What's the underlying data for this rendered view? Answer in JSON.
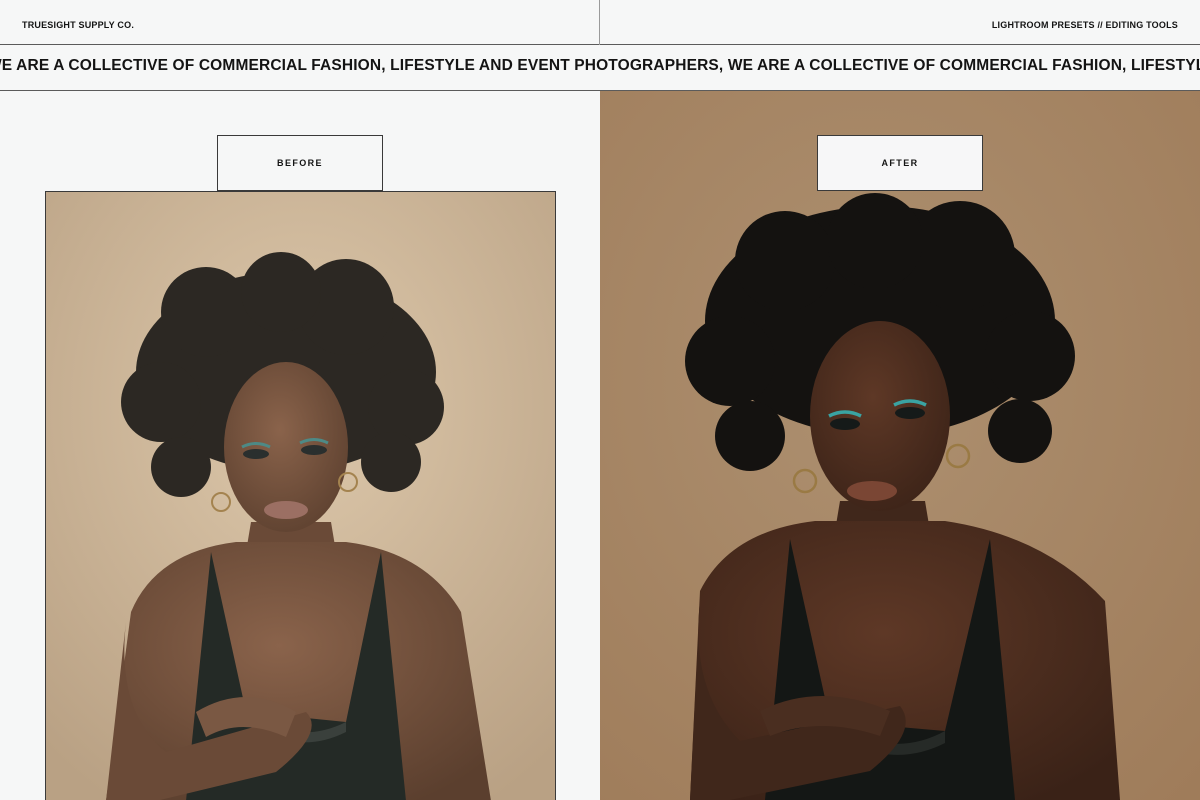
{
  "header": {
    "brand": "TRUESIGHT SUPPLY CO.",
    "tagline": "LIGHTROOM PRESETS // EDITING TOOLS"
  },
  "ticker": {
    "text": "WE ARE A COLLECTIVE OF COMMERCIAL FASHION, LIFESTYLE AND EVENT PHOTOGRAPHERS, WE ARE A COLLECTIVE OF COMMERCIAL FASHION, LIFESTYLE AND EVENT PHOTOGRAPHERS,"
  },
  "comparison": {
    "before_label": "BEFORE",
    "after_label": "AFTER"
  },
  "colors": {
    "page_background": "#f6f7f7",
    "before_backdrop": "#d2bb9c",
    "after_backdrop": "#a88a68",
    "rule_color": "#5b5b5b"
  }
}
